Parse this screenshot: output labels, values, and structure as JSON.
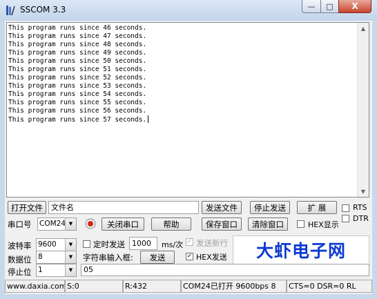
{
  "window": {
    "title": "SSCOM 3.3",
    "min": "—",
    "max": "□",
    "close": "X"
  },
  "output": {
    "lines": [
      "This program runs since 46 seconds.",
      "This program runs since 47 seconds.",
      "This program runs since 48 seconds.",
      "This program runs since 49 seconds.",
      "This program runs since 50 seconds.",
      "This program runs since 51 seconds.",
      "This program runs since 52 seconds.",
      "This program runs since 53 seconds.",
      "This program runs since 54 seconds.",
      "This program runs since 55 seconds.",
      "This program runs since 56 seconds.",
      "This program runs since 57 seconds."
    ]
  },
  "row1": {
    "open_file": "打开文件",
    "filename": "文件名",
    "send_file": "发送文件",
    "stop_send": "停止发送",
    "extend": "扩 展",
    "rts": "RTS",
    "dtr": "DTR"
  },
  "row2": {
    "port_label": "串口号",
    "port_value": "COM24",
    "close_port": "关闭串口",
    "help": "帮助",
    "save_window": "保存窗口",
    "clear_window": "清除窗口",
    "hex_display": "HEX显示"
  },
  "row3": {
    "baud_label": "波特率",
    "baud_value": "9600",
    "timed_send": "定时发送",
    "interval": "1000",
    "unit": "ms/次",
    "send_newline": "发送新行"
  },
  "row4": {
    "databits_label": "数据位",
    "databits_value": "8",
    "string_input_label": "字符串输入框:",
    "send": "发送",
    "hex_send": "HEX发送",
    "check_mark": "✓"
  },
  "row5": {
    "stopbits_label": "停止位",
    "stopbits_value": "1",
    "input_value": "05"
  },
  "logo": {
    "text": "大虾电子网"
  },
  "statusbar": {
    "url": "www.daxia.com",
    "sent": "S:0",
    "received": "R:432",
    "port_status": "COM24已打开  9600bps  8",
    "lines": "CTS=0 DSR=0 RL"
  },
  "colors": {
    "logo": "#0d3ad0",
    "record_dot": "#d8231a"
  }
}
